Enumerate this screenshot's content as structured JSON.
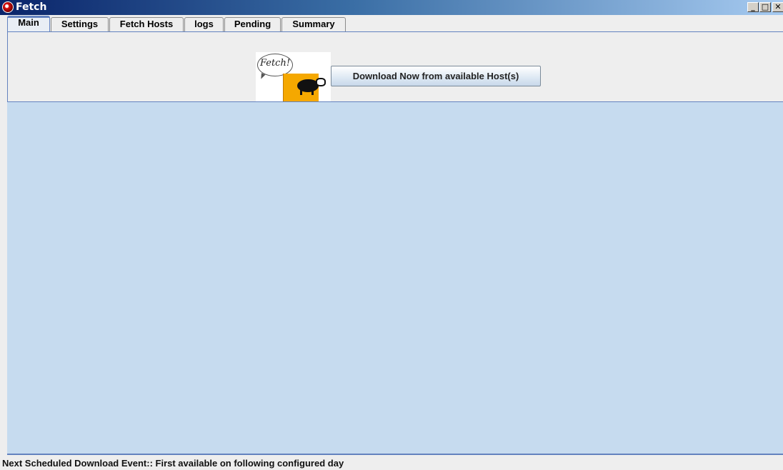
{
  "window": {
    "title": "Fetch",
    "controls": {
      "minimize": "_",
      "maximize": "□",
      "close": "✕"
    }
  },
  "tabs": [
    {
      "label": "Main",
      "active": true
    },
    {
      "label": "Settings",
      "active": false
    },
    {
      "label": "Fetch Hosts",
      "active": false
    },
    {
      "label": "logs",
      "active": false
    },
    {
      "label": "Pending",
      "active": false
    },
    {
      "label": "Summary",
      "active": false
    }
  ],
  "toolbar": {
    "logo_text": "Fetch!",
    "download_button_label": "Download Now from available Host(s)"
  },
  "statusbar": {
    "text": "Next Scheduled Download Event:: First available on following configured day"
  },
  "colors": {
    "titlebar_start": "#0a246a",
    "content_background": "#c6dbef",
    "tab_accent": "#6382bf",
    "logo_door": "#f5a800"
  }
}
